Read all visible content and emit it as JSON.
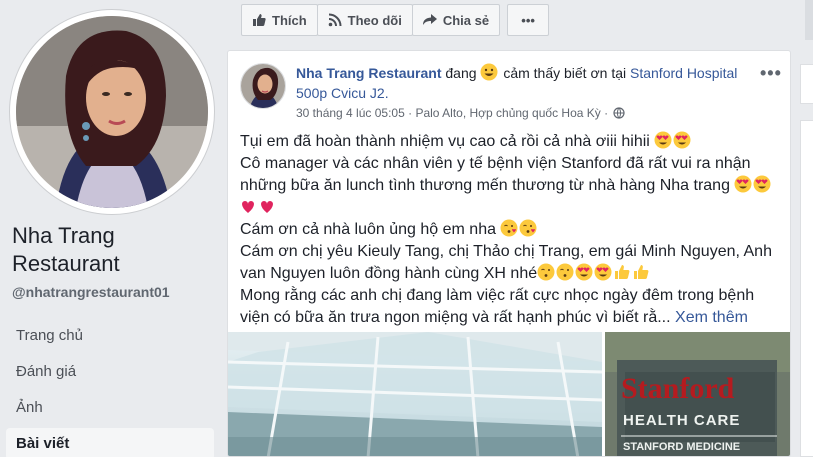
{
  "colors": {
    "link": "#365899",
    "background": "#e9ebee"
  },
  "sidebar": {
    "page_name": "Nha Trang Restaurant",
    "handle": "@nhatrangrestaurant01",
    "nav": [
      "Trang chủ",
      "Đánh giá",
      "Ảnh",
      "Bài viết"
    ],
    "active_nav": "Bài viết"
  },
  "actions": {
    "like_label": "Thích",
    "follow_label": "Theo dõi",
    "share_label": "Chia sẻ",
    "more_label": "•••"
  },
  "post": {
    "author": "Nha Trang Restaurant",
    "status_prefix": "đang",
    "feeling": "cảm thấy biết ơn tại",
    "place": "Stanford Hospital 500p Cvicu J2.",
    "timestamp": "30 tháng 4 lúc 05:05",
    "location": "Palo Alto, Hợp chủng quốc Hoa Kỳ",
    "meta_sep": "·",
    "options": "•••",
    "lines": [
      "Tụi em đã hoàn thành nhiệm vụ cao cả rồi cả nhà ơiii hihii",
      "Cô manager và các nhân viên y tế bệnh viện Stanford đã rất vui ra nhận những bữa ăn lunch tình thương mến thương từ nhà hàng Nha trang",
      "Cám ơn cả nhà luôn ủng hộ em nha",
      "Cám ơn chị yêu Kieuly Tang, chị Thảo chị Trang, em gái Minh Nguyen, Anh van Nguyen luôn đồng hành cùng XH nhé",
      "Mong rằng các anh chị đang làm việc rất cực nhọc ngày đêm trong bệnh viện có bữa ăn trưa ngon miệng và rất hạnh phúc vì biết rằ..."
    ],
    "see_more": "Xem thêm",
    "photo2_text": {
      "brand": "Stanford",
      "line2": "HEALTH CARE",
      "line3": "STANFORD MEDICINE"
    }
  }
}
